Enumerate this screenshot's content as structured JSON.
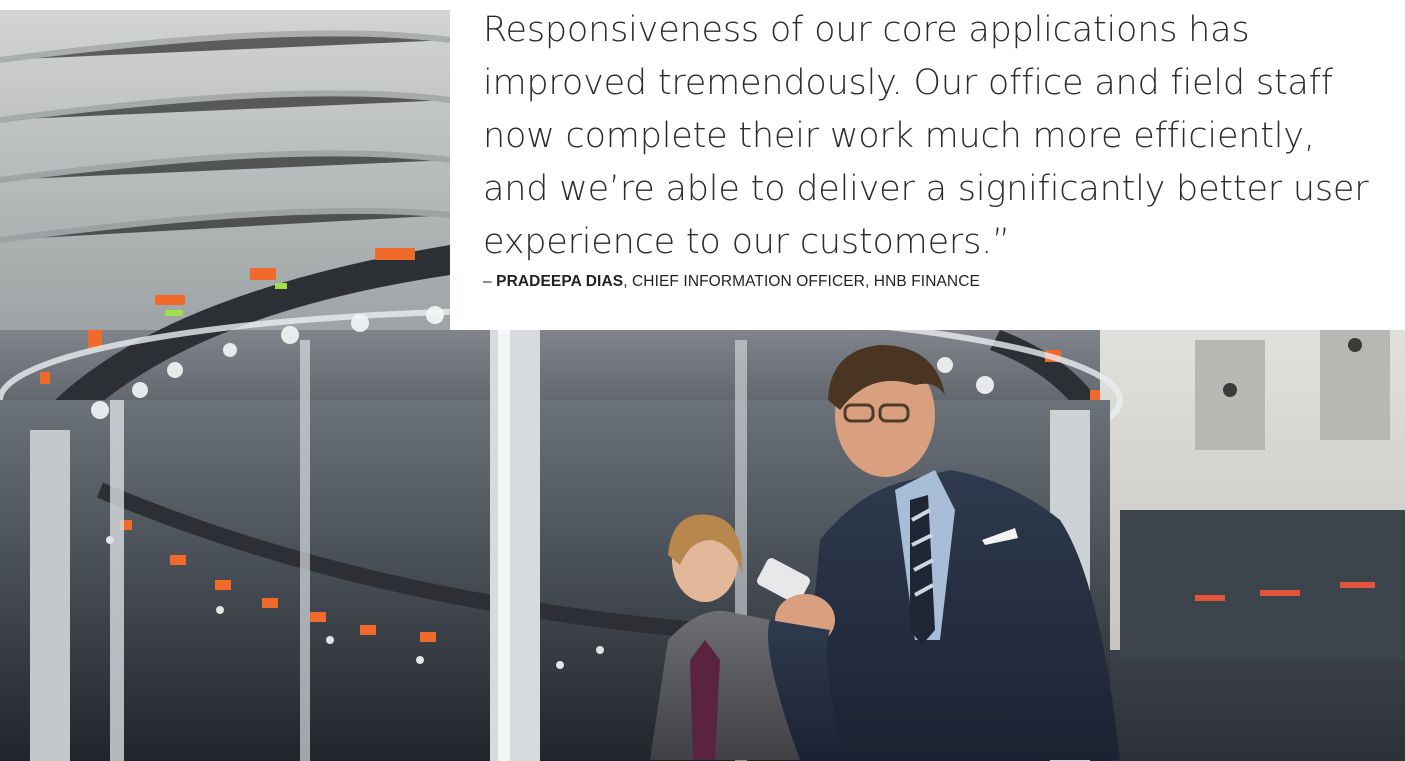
{
  "quote": {
    "text": "Responsiveness of our core applications has improved tremendously. Our office and field staff now complete their work much more efficiently, and we’re able to deliver a significantly better user experience to our customers.”",
    "dash": "– ",
    "name": "PRADEEPA DIAS",
    "role": ", CHIEF INFORMATION OFFICER, HNB FINANCE"
  },
  "photo": {
    "subject": "stock-exchange-floor-photo"
  }
}
